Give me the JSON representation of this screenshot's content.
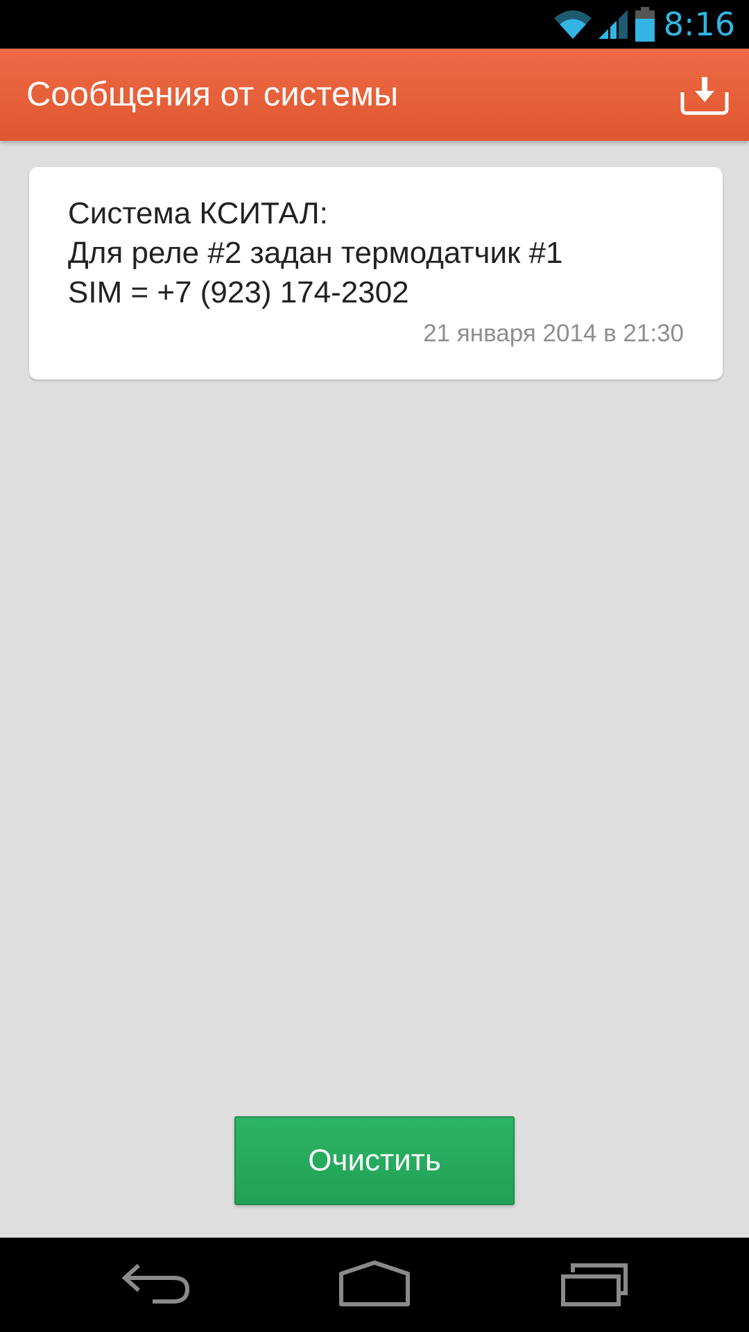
{
  "status_bar": {
    "time": "8:16",
    "icons": [
      "wifi-icon",
      "signal-icon",
      "battery-icon"
    ],
    "accent_color": "#33b5e5"
  },
  "action_bar": {
    "title": "Сообщения от системы",
    "action_icon": "download-icon",
    "color": "#e8603a"
  },
  "messages": [
    {
      "text": "Система КСИТАЛ:\nДля реле #2 задан термодатчик #1\nSIM = +7 (923) 174-2302",
      "date": "21 января 2014 в 21:30"
    }
  ],
  "clear_button": {
    "label": "Очистить",
    "color": "#27a95d"
  },
  "nav_bar": {
    "icons": [
      "back-icon",
      "home-icon",
      "recent-apps-icon"
    ]
  }
}
